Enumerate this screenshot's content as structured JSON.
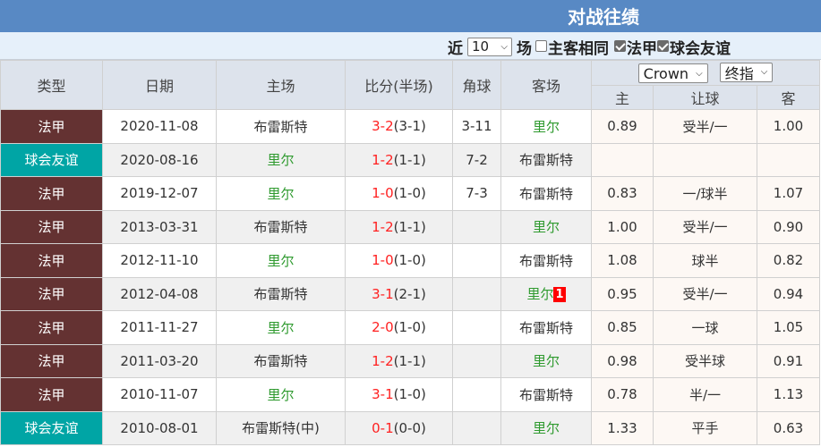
{
  "header": {
    "title": "对战往绩"
  },
  "toolbar": {
    "prefix": "近",
    "count_select": "10",
    "suffix": "场",
    "filters": [
      {
        "label": "主客相同",
        "checked": false
      },
      {
        "label": "法甲",
        "checked": true
      },
      {
        "label": "球会友谊",
        "checked": true
      }
    ]
  },
  "table": {
    "columns": {
      "type": "类型",
      "date": "日期",
      "home": "主场",
      "score": "比分(半场)",
      "corner": "角球",
      "away": "客场",
      "home_odds": "主",
      "handicap": "让球",
      "away_odds": "客"
    },
    "bookmaker_select": "Crown",
    "odds_type_select": "终指",
    "rows": [
      {
        "type": "法甲",
        "type_kind": "league",
        "date": "2020-11-08",
        "home": "布雷斯特",
        "home_highlight": false,
        "score": "3-2",
        "half": "(3-1)",
        "corner": "3-11",
        "away": "里尔",
        "away_highlight": true,
        "away_badge": "",
        "home_odds": "0.89",
        "handicap": "受半/一",
        "away_odds": "1.00"
      },
      {
        "type": "球会友谊",
        "type_kind": "friendly",
        "date": "2020-08-16",
        "home": "里尔",
        "home_highlight": true,
        "score": "1-2",
        "half": "(1-1)",
        "corner": "7-2",
        "away": "布雷斯特",
        "away_highlight": false,
        "away_badge": "",
        "home_odds": "",
        "handicap": "",
        "away_odds": ""
      },
      {
        "type": "法甲",
        "type_kind": "league",
        "date": "2019-12-07",
        "home": "里尔",
        "home_highlight": true,
        "score": "1-0",
        "half": "(1-0)",
        "corner": "7-3",
        "away": "布雷斯特",
        "away_highlight": false,
        "away_badge": "",
        "home_odds": "0.83",
        "handicap": "一/球半",
        "away_odds": "1.07"
      },
      {
        "type": "法甲",
        "type_kind": "league",
        "date": "2013-03-31",
        "home": "布雷斯特",
        "home_highlight": false,
        "score": "1-2",
        "half": "(1-1)",
        "corner": "",
        "away": "里尔",
        "away_highlight": true,
        "away_badge": "",
        "home_odds": "1.00",
        "handicap": "受半/一",
        "away_odds": "0.90"
      },
      {
        "type": "法甲",
        "type_kind": "league",
        "date": "2012-11-10",
        "home": "里尔",
        "home_highlight": true,
        "score": "1-0",
        "half": "(1-0)",
        "corner": "",
        "away": "布雷斯特",
        "away_highlight": false,
        "away_badge": "",
        "home_odds": "1.08",
        "handicap": "球半",
        "away_odds": "0.82"
      },
      {
        "type": "法甲",
        "type_kind": "league",
        "date": "2012-04-08",
        "home": "布雷斯特",
        "home_highlight": false,
        "score": "3-1",
        "half": "(2-1)",
        "corner": "",
        "away": "里尔",
        "away_highlight": true,
        "away_badge": "1",
        "home_odds": "0.95",
        "handicap": "受半/一",
        "away_odds": "0.94"
      },
      {
        "type": "法甲",
        "type_kind": "league",
        "date": "2011-11-27",
        "home": "里尔",
        "home_highlight": true,
        "score": "2-0",
        "half": "(1-0)",
        "corner": "",
        "away": "布雷斯特",
        "away_highlight": false,
        "away_badge": "",
        "home_odds": "0.85",
        "handicap": "一球",
        "away_odds": "1.05"
      },
      {
        "type": "法甲",
        "type_kind": "league",
        "date": "2011-03-20",
        "home": "布雷斯特",
        "home_highlight": false,
        "score": "1-2",
        "half": "(1-1)",
        "corner": "",
        "away": "里尔",
        "away_highlight": true,
        "away_badge": "",
        "home_odds": "0.98",
        "handicap": "受半球",
        "away_odds": "0.91"
      },
      {
        "type": "法甲",
        "type_kind": "league",
        "date": "2010-11-07",
        "home": "里尔",
        "home_highlight": true,
        "score": "3-1",
        "half": "(1-0)",
        "corner": "",
        "away": "布雷斯特",
        "away_highlight": false,
        "away_badge": "",
        "home_odds": "0.78",
        "handicap": "半/一",
        "away_odds": "1.13"
      },
      {
        "type": "球会友谊",
        "type_kind": "friendly",
        "date": "2010-08-01",
        "home": "布雷斯特(中)",
        "home_highlight": false,
        "score": "0-1",
        "half": "(0-0)",
        "corner": "",
        "away": "里尔",
        "away_highlight": true,
        "away_badge": "",
        "home_odds": "1.33",
        "handicap": "平手",
        "away_odds": "0.63"
      }
    ]
  },
  "colors": {
    "title_bar": "#5889c4",
    "league_badge": "#643232",
    "friendly_badge": "#00a5a5",
    "highlight_team": "#2e9a2e",
    "score": "#ff2020"
  }
}
